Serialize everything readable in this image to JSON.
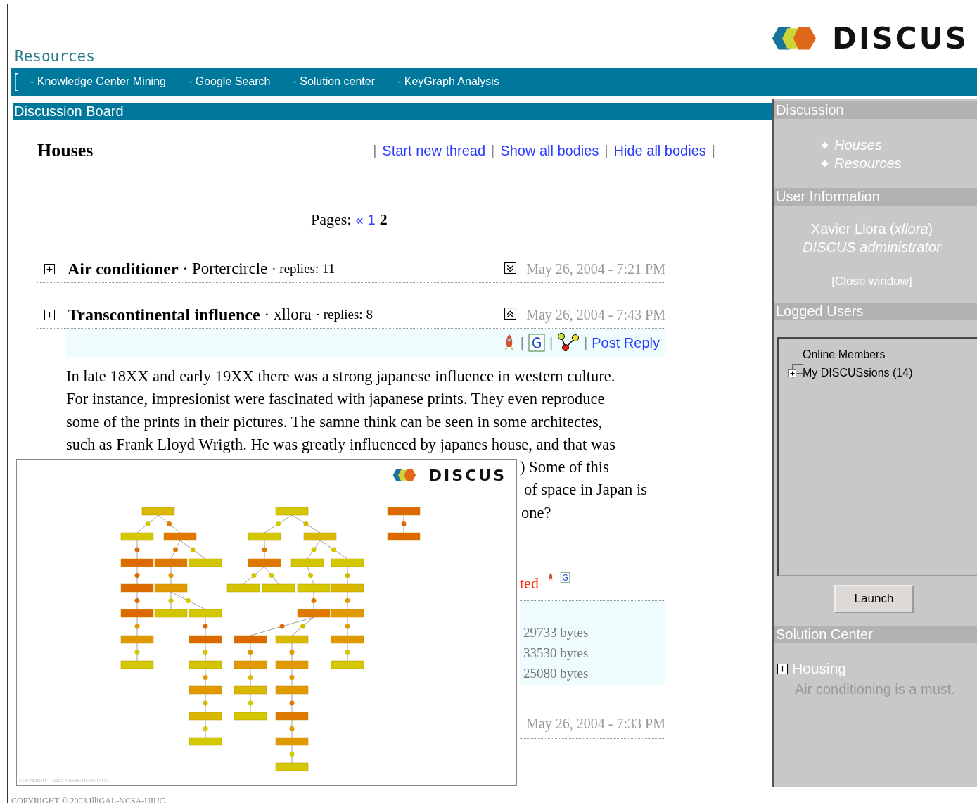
{
  "header": {
    "section": "Resources",
    "logo": "DISCUS"
  },
  "nav": {
    "bracket": "[",
    "links": [
      "- Knowledge Center Mining",
      "- Google Search",
      "- Solution center",
      "- KeyGraph Analysis"
    ]
  },
  "board": {
    "title": "Discussion Board",
    "forum": "Houses",
    "actions": [
      "Start new thread",
      "Show all bodies",
      "Hide all bodies"
    ],
    "separator": "|",
    "pages": {
      "label": "Pages:",
      "prev": "«",
      "items": [
        {
          "label": "1",
          "selected": false
        },
        {
          "label": "2",
          "selected": true
        }
      ]
    }
  },
  "threads": [
    {
      "title": "Air conditioner",
      "author": "· Portercircle",
      "replies": "· replies: 11",
      "date": "May 26, 2004 - 7:21 PM",
      "expanded": false
    },
    {
      "title": "Transcontinental influence",
      "author": "· xllora",
      "replies": "· replies: 8",
      "date": "May 26, 2004 - 7:43 PM",
      "expanded": true,
      "post_reply": "Post Reply",
      "body": [
        "In late 18XX and early 19XX there was a strong japanese influence in western culture.",
        "For instance, impresionist were fascinated with japanese prints. They even reproduce",
        "some of the prints in their pictures. The samne think can be seen in some architectes,",
        "such as Frank Lloyd Wrigth. He was greatly influenced by japanes house, and that was"
      ],
      "body_fragments": [
        ") Some of this",
        "of space in Japan is",
        "one?"
      ],
      "reply_fragment": "ted",
      "attachments": [
        "29733 bytes",
        "33530 bytes",
        "25080 bytes"
      ],
      "reply_date": "May 26, 2004 - 7:33 PM"
    }
  ],
  "keygraph_window": {
    "logo": "DISCUS",
    "copyright": "COPYRIGHT © 2003 IlliGAL-NCSA-UIUC."
  },
  "sidebar": {
    "discussion": {
      "title": "Discussion",
      "items": [
        "Houses",
        "Resources"
      ]
    },
    "user": {
      "title": "User Information",
      "name": "Xavier Llora (",
      "login": "xllora",
      "name_end": ")",
      "role": "DISCUS administrator",
      "close": "[Close window]"
    },
    "logged": {
      "title": "Logged Users",
      "tree": [
        {
          "label": "Online Members",
          "kind": "leaf"
        },
        {
          "label": "My DISCUSsions (14)",
          "kind": "branch"
        }
      ],
      "button": "Launch"
    },
    "solution": {
      "title": "Solution Center",
      "items": [
        {
          "label": "Housing",
          "expanded": false,
          "description": "Air conditioning is a must."
        }
      ]
    }
  },
  "footer": "COPYRIGHT © 2003 IlliGAL-NCSA-UIUC."
}
